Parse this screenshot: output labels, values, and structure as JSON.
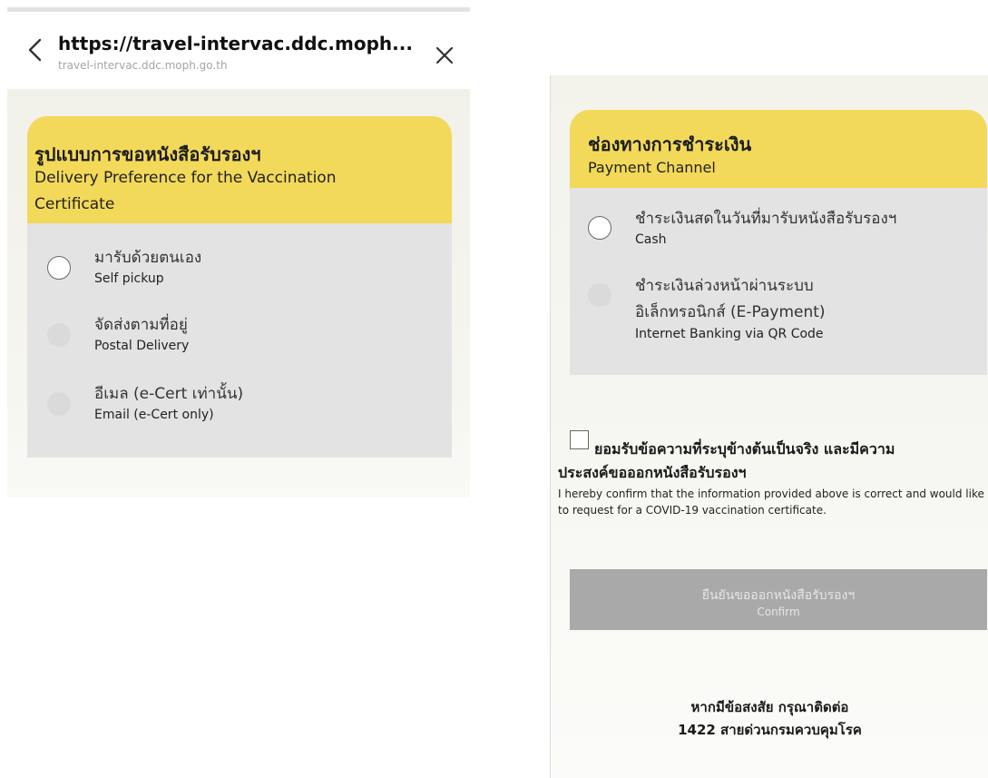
{
  "browser": {
    "url_title": "https://travel-intervac.ddc.moph...",
    "url_domain": "travel-intervac.ddc.moph.go.th"
  },
  "delivery": {
    "title_th": "รูปแบบการขอหนังสือรับรองฯ",
    "title_en_line1": "Delivery Preference for the Vaccination",
    "title_en_line2": "Certificate",
    "options": [
      {
        "th": "มารับด้วยตนเอง",
        "en": "Self pickup"
      },
      {
        "th": "จัดส่งตามที่อยู่",
        "en": "Postal Delivery"
      },
      {
        "th": "อีเมล (e-Cert เท่านั้น)",
        "en": "Email (e-Cert only)"
      }
    ]
  },
  "payment": {
    "title_th": "ช่องทางการชำระเงิน",
    "title_en": "Payment Channel",
    "options": [
      {
        "th": "ชำระเงินสดในวันที่มารับหนังสือรับรองฯ",
        "en": "Cash"
      },
      {
        "th_line1": "ชำระเงินล่วงหน้าผ่านระบบ",
        "th_line2": "อิเล็กทรอนิกส์ (E-Payment)",
        "en": "Internet Banking via QR Code"
      }
    ]
  },
  "consent": {
    "th_line1": "ยอมรับข้อความที่ระบุข้างต้นเป็นจริง และมีความ",
    "th_line2": "ประสงค์ขอออกหนังสือรับรองฯ",
    "en": "I hereby confirm that the information provided above is correct and would like to request for a COVID-19 vaccination certificate."
  },
  "confirm": {
    "label_th": "ยืนยันขอออกหนังสือรับรองฯ",
    "label_en": "Confirm"
  },
  "contact": {
    "line1": "หากมีข้อสงสัย กรุณาติดต่อ",
    "line2": "1422 สายด่วนกรมควบคุมโรค"
  },
  "colors": {
    "header_yellow": "#f3d95a",
    "card_gray": "#e3e3e3",
    "button_gray": "#a9a9a9"
  },
  "icons": [
    "back-arrow-icon",
    "close-icon"
  ]
}
